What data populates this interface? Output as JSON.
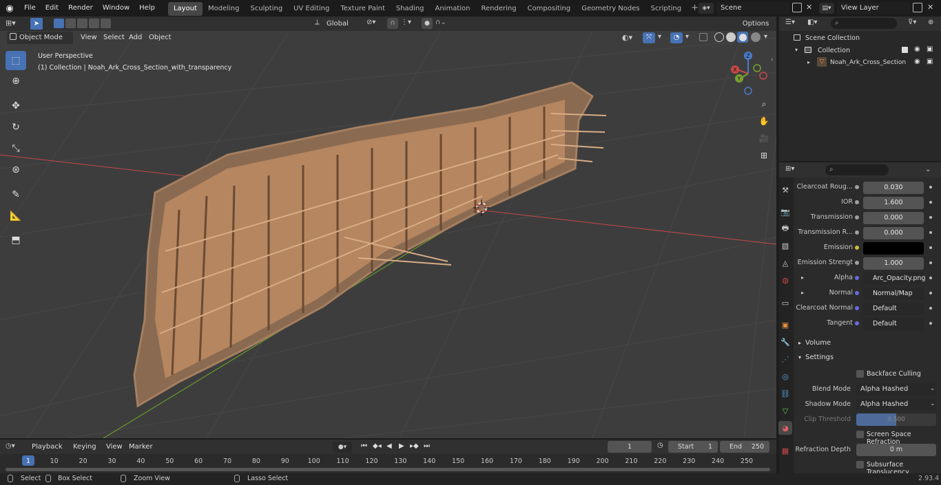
{
  "topbar": {
    "menus": [
      "File",
      "Edit",
      "Render",
      "Window",
      "Help"
    ],
    "workspaces": [
      "Layout",
      "Modeling",
      "Sculpting",
      "UV Editing",
      "Texture Paint",
      "Shading",
      "Animation",
      "Rendering",
      "Compositing",
      "Geometry Nodes",
      "Scripting"
    ],
    "active_workspace": "Layout",
    "scene": "Scene",
    "view_layer": "View Layer",
    "add_tab": "+"
  },
  "tool_header": {
    "transform_orientation": "Global",
    "options_label": "Options"
  },
  "viewport": {
    "mode": "Object Mode",
    "menus": [
      "View",
      "Select",
      "Add",
      "Object"
    ],
    "perspective_label": "User Perspective",
    "collection_label": "(1) Collection | Noah_Ark_Cross_Section_with_transparency",
    "gizmo_axes": {
      "x": "X",
      "y": "Y",
      "z": "Z"
    },
    "colors": {
      "bg": "#3c3c3c",
      "grid": "#474747",
      "x_axis": "#c84848",
      "y_axis": "#6a9a2a",
      "wood": "#b58660"
    }
  },
  "outliner": {
    "scene_collection": "Scene Collection",
    "collection": "Collection",
    "object": "Noah_Ark_Cross_Section"
  },
  "properties": {
    "rows": [
      {
        "label": "Clearcoat Roug...",
        "value": "0.030",
        "type": "num"
      },
      {
        "label": "IOR",
        "value": "1.600",
        "type": "num"
      },
      {
        "label": "Transmission",
        "value": "0.000",
        "type": "num"
      },
      {
        "label": "Transmission R...",
        "value": "0.000",
        "type": "num"
      },
      {
        "label": "Emission",
        "value": "",
        "type": "color"
      },
      {
        "label": "Emission Strengt",
        "value": "1.000",
        "type": "num"
      },
      {
        "label": "Alpha",
        "value": "Arc_Opacity.png",
        "type": "link"
      },
      {
        "label": "Normal",
        "value": "Normal/Map",
        "type": "link"
      },
      {
        "label": "Clearcoat Normal",
        "value": "Default",
        "type": "link"
      },
      {
        "label": "Tangent",
        "value": "Default",
        "type": "link"
      }
    ],
    "volume_panel": "Volume",
    "settings_panel": "Settings",
    "backface_culling": "Backface Culling",
    "blend_mode_label": "Blend Mode",
    "blend_mode_value": "Alpha Hashed",
    "shadow_mode_label": "Shadow Mode",
    "shadow_mode_value": "Alpha Hashed",
    "clip_threshold_label": "Clip Threshold",
    "clip_threshold_value": "0.500",
    "clip_threshold_fraction": 0.5,
    "screen_space_refraction": "Screen Space Refraction",
    "refraction_depth_label": "Refraction Depth",
    "refraction_depth_value": "0 m",
    "subsurface_translucency": "Subsurface Translucency"
  },
  "timeline": {
    "menus": [
      "Playback",
      "Keying",
      "View",
      "Marker"
    ],
    "current_frame": "1",
    "start_label": "Start",
    "start_value": "1",
    "end_label": "End",
    "end_value": "250",
    "frame_numbers": [
      "1",
      "10",
      "20",
      "30",
      "40",
      "50",
      "60",
      "70",
      "80",
      "90",
      "100",
      "110",
      "120",
      "130",
      "140",
      "150",
      "160",
      "170",
      "180",
      "190",
      "200",
      "210",
      "220",
      "230",
      "240",
      "250"
    ]
  },
  "statusbar": {
    "select": "Select",
    "box_select": "Box Select",
    "zoom_view": "Zoom View",
    "lasso_select": "Lasso Select",
    "version": "2.93.4"
  }
}
